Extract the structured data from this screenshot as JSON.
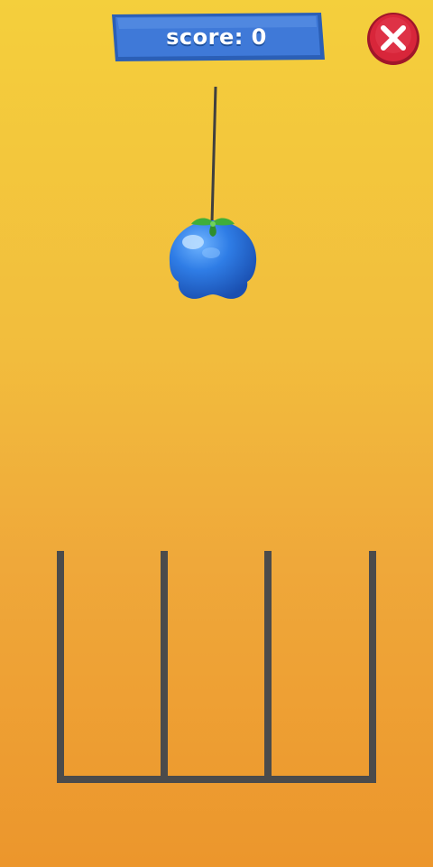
{
  "hud": {
    "score_label": "score: 0"
  },
  "colors": {
    "panel_fill": "#3f79d8",
    "panel_border": "#2b5fb6",
    "close_fill": "#d8263a",
    "rope": "#3f3f3f",
    "bin_walls": "#4b4b4b",
    "fruit": "#2f7de6",
    "leaf": "#3fae3a"
  },
  "icons": {
    "close": "close-icon",
    "fruit": "blueberry-icon"
  }
}
